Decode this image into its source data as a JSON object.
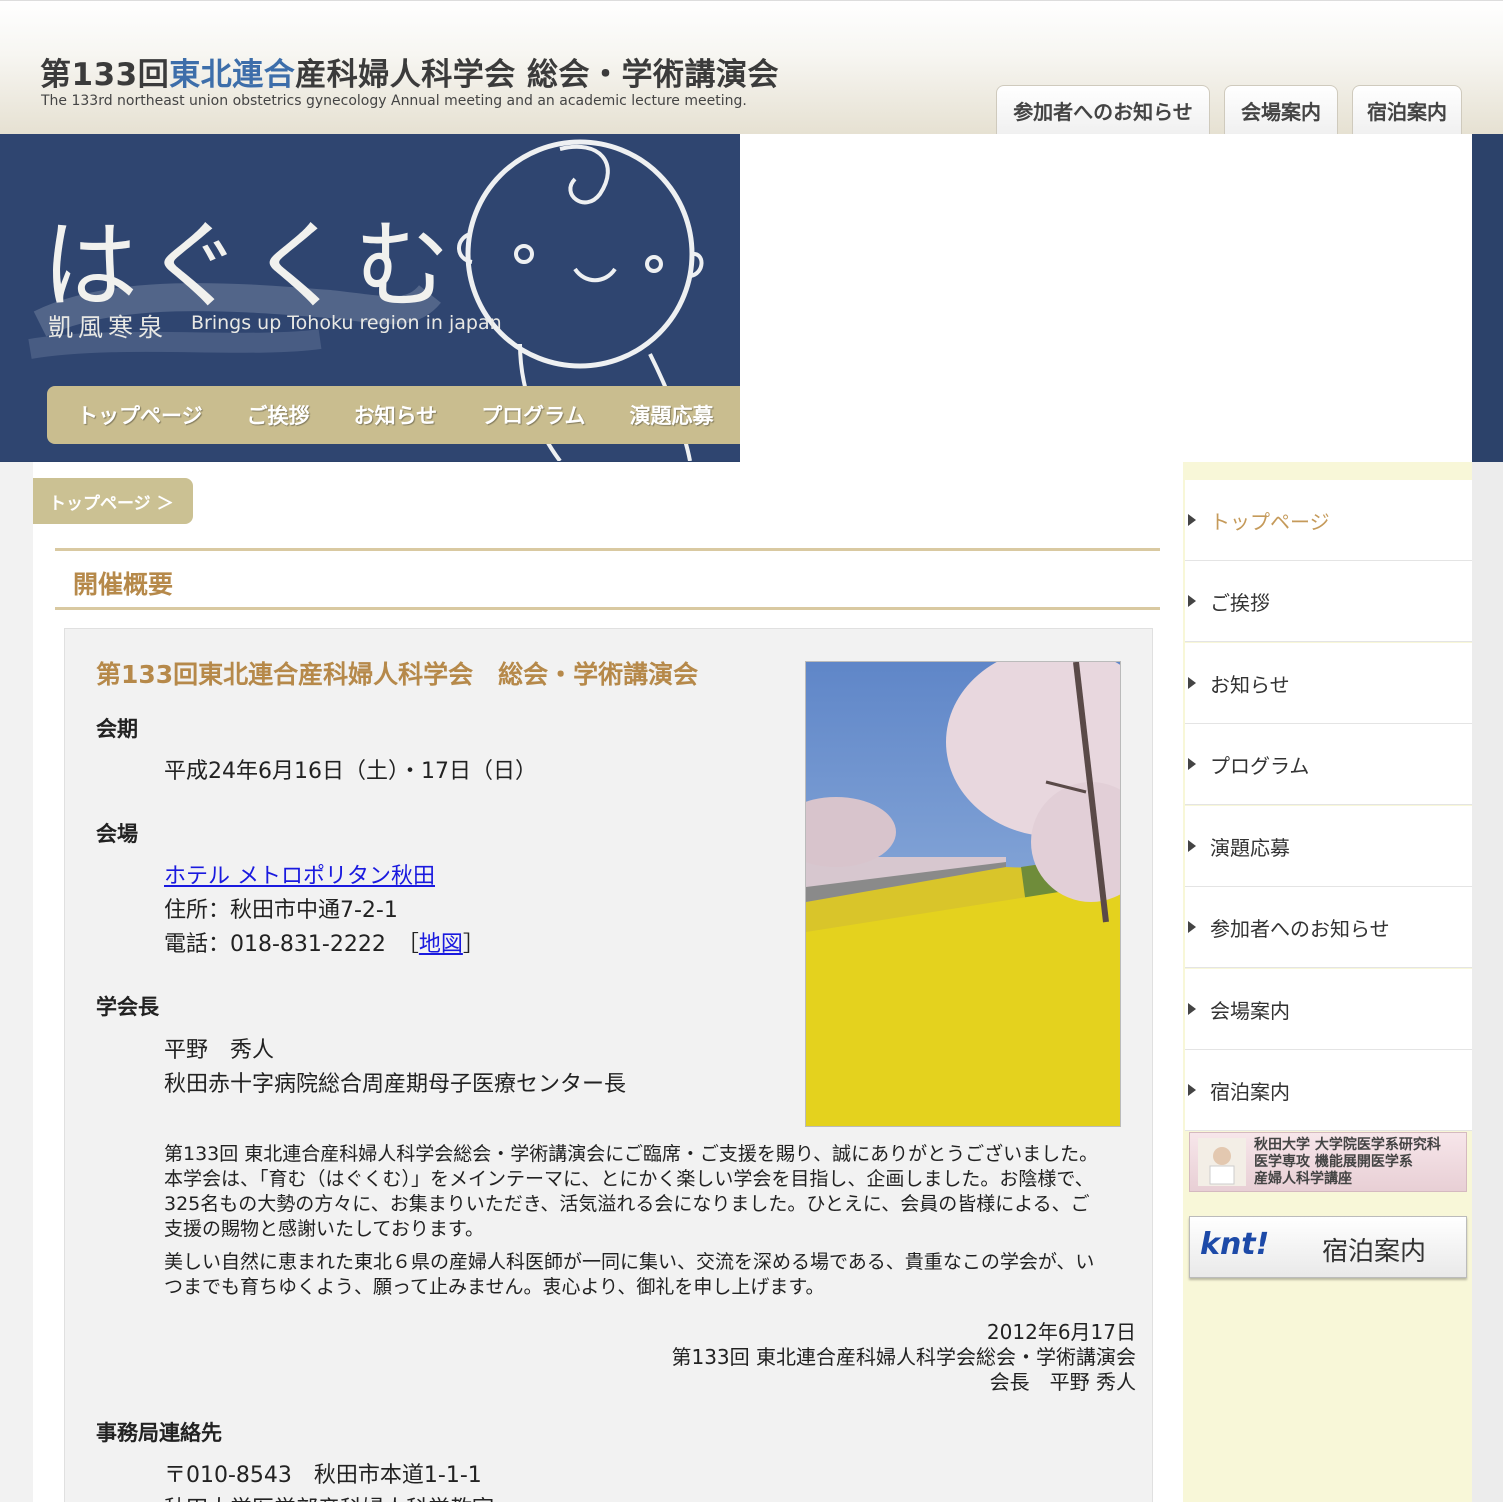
{
  "header": {
    "title_pre": "第133回",
    "title_hl": "東北連合",
    "title_post": "産科婦人科学会 総会・学術講演会",
    "subtitle": "The 133rd northeast union obstetrics gynecology Annual meeting and an academic lecture meeting.",
    "tabs": [
      "参加者へのお知らせ",
      "会場案内",
      "宿泊案内"
    ]
  },
  "banner": {
    "title": "はぐくむ",
    "sub_jp": "凱風寒泉",
    "sub_en": "Brings up Tohoku region in japan"
  },
  "mainnav": [
    "トップページ",
    "ご挨拶",
    "お知らせ",
    "プログラム",
    "演題応募"
  ],
  "breadcrumb": "トップページ ＞",
  "page_heading": "開催概要",
  "panel": {
    "title": "第133回東北連合産科婦人科学会　総会・学術講演会",
    "kaiki_label": "会期",
    "kaiki_value": "平成24年6月16日（土）・17日（日）",
    "kaijo_label": "会場",
    "hotel_link": "ホテル メトロポリタン秋田",
    "address": "住所：秋田市中通7-2-1",
    "tel": "電話：018-831-2222　［",
    "map_link": "地図",
    "tel_close": "］",
    "president_label": "学会長",
    "president_name": "平野　秀人",
    "president_title": "秋田赤十字病院総合周産期母子医療センター長",
    "para1": "第133回 東北連合産科婦人科学会総会・学術講演会にご臨席・ご支援を賜り、誠にありがとうございました。 本学会は、「育む（はぐくむ）」をメインテーマに、とにかく楽しい学会を目指し、企画しました。お陰様で、325名もの大勢の方々に、お集まりいただき、活気溢れる会になりました。ひとえに、会員の皆様による、ご支援の賜物と感謝いたしております。",
    "para2": "美しい自然に恵まれた東北６県の産婦人科医師が一同に集い、交流を深める場である、貴重なこの学会が、いつまでも育ちゆくよう、願って止みません。衷心より、御礼を申し上げます。",
    "sig_date": "2012年6月17日",
    "sig_event": "第133回 東北連合産科婦人科学会総会・学術講演会",
    "sig_name": "会長　平野 秀人",
    "office_label": "事務局連絡先",
    "office_addr": "〒010-8543　秋田市本道1-1-1",
    "office_dept": "秋田大学医学部産科婦人科学教室"
  },
  "sidebar": {
    "items": [
      "トップページ",
      "ご挨拶",
      "お知らせ",
      "プログラム",
      "演題応募",
      "参加者へのお知らせ",
      "会場案内",
      "宿泊案内"
    ],
    "univ_banner": [
      "秋田大学 大学院医学系研究科",
      "医学専攻 機能展開医学系",
      "産婦人科学講座"
    ],
    "knt_logo": "knt!",
    "knt_label": "宿泊案内"
  },
  "colors": {
    "accent_gold": "#b6894a",
    "nav_bg": "#c9bd8f",
    "banner_navy": "#2c426a",
    "link_blue": "#1a1adf",
    "title_blue": "#3d6eaa"
  },
  "icons": [
    "arrow-right-icon",
    "baby-illustration",
    "photo-sakura-nanohana"
  ]
}
